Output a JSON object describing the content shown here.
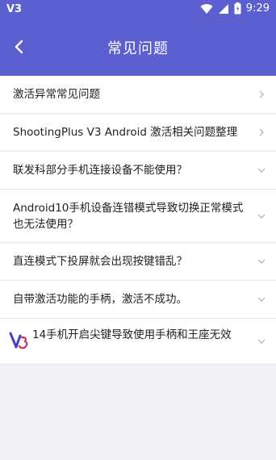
{
  "status_bar": {
    "app_badge": "V3",
    "time": "9:29"
  },
  "header": {
    "title": "常见问题"
  },
  "faq": {
    "items": [
      {
        "label": "激活异常常见问题",
        "chevron": "right"
      },
      {
        "label": "ShootingPlus V3 Android 激活相关问题整理",
        "chevron": "right"
      },
      {
        "label": "联发科部分手机连接设备不能使用？",
        "chevron": "down"
      },
      {
        "label": "Android10手机设备连错模式导致切换正常模式也无法使用？",
        "chevron": "down"
      },
      {
        "label": "直连模式下投屏就会出现按键错乱？",
        "chevron": "down"
      },
      {
        "label": "自带激活功能的手柄，激活不成功。",
        "chevron": "down"
      },
      {
        "label": "14手机开启尖键导致使用手柄和王座无效",
        "chevron": "down"
      }
    ]
  },
  "colors": {
    "primary": "#5b5fcf",
    "background": "#f2f1f6",
    "text": "#222222",
    "chevron": "#b8b8bf"
  }
}
